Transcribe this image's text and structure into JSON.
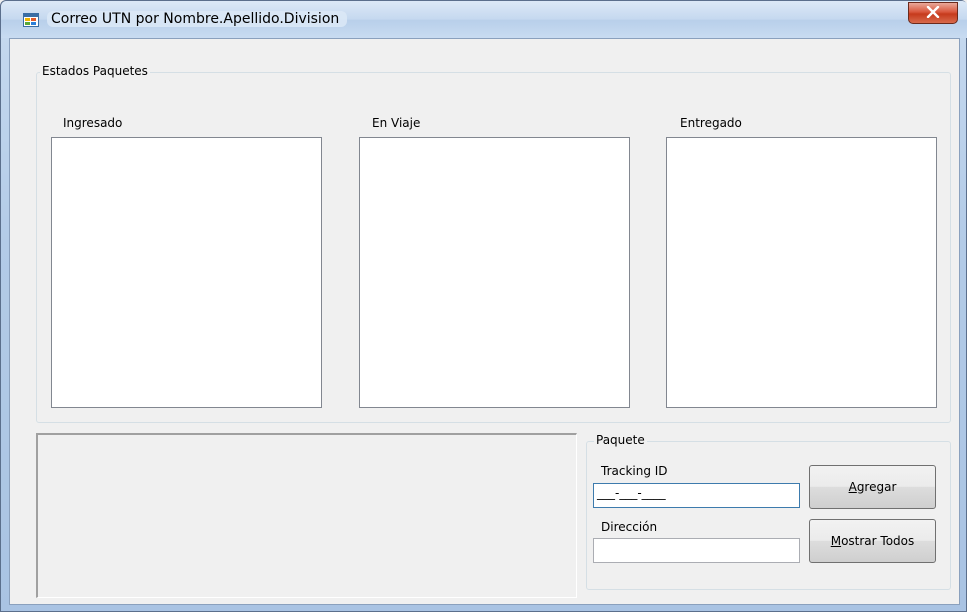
{
  "window": {
    "title": "Correo UTN por Nombre.Apellido.Division",
    "icon": "windows-form-icon",
    "close_icon": "close-icon"
  },
  "estados": {
    "caption": "Estados Paquetes",
    "columns": [
      {
        "label": "Ingresado",
        "items": []
      },
      {
        "label": "En Viaje",
        "items": []
      },
      {
        "label": "Entregado",
        "items": []
      }
    ]
  },
  "paquete": {
    "caption": "Paquete",
    "tracking_label": "Tracking ID",
    "tracking_mask": "___-___-____",
    "direccion_label": "Dirección",
    "direccion_value": "",
    "agregar_mnemonic": "A",
    "agregar_rest": "gregar",
    "mostrar_mnemonic": "M",
    "mostrar_rest": "ostrar Todos"
  },
  "colors": {
    "titlebar": "#c5d8ef",
    "close_button": "#d9573d",
    "form_background": "#f0f0f0"
  }
}
